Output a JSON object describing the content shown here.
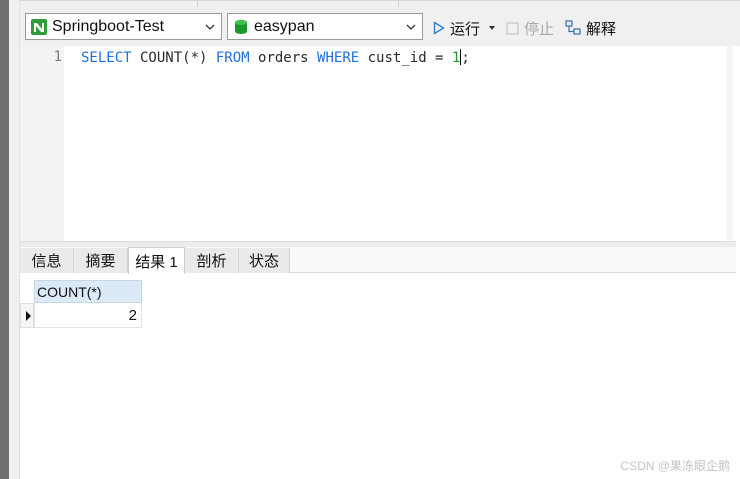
{
  "toolbar": {
    "connection": {
      "label": "Springboot-Test",
      "icon": "mysql-connection-icon",
      "color": "#2e9e3a"
    },
    "database": {
      "label": "easypan",
      "icon": "database-icon",
      "color": "#1a9a2a"
    },
    "run_label": "运行",
    "stop_label": "停止",
    "explain_label": "解释"
  },
  "editor": {
    "line_number": "1",
    "tokens": {
      "select": "SELECT",
      "count": " COUNT(*) ",
      "from": "FROM",
      "table": " orders ",
      "where": "WHERE",
      "condition": " cust_id = ",
      "value_a": "1",
      "semicolon": ";"
    }
  },
  "result_tabs": [
    {
      "label": "信息",
      "active": false
    },
    {
      "label": "摘要",
      "active": false
    },
    {
      "label": "结果 1",
      "active": true
    },
    {
      "label": "剖析",
      "active": false
    },
    {
      "label": "状态",
      "active": false
    }
  ],
  "result_grid": {
    "columns": [
      "COUNT(*)"
    ],
    "rows": [
      [
        "2"
      ]
    ]
  },
  "colors": {
    "keyword": "#1f6fe0",
    "number": "#1a9a2a",
    "header_bg": "#dce9f7"
  },
  "watermark": "CSDN @果冻眼企鹅"
}
